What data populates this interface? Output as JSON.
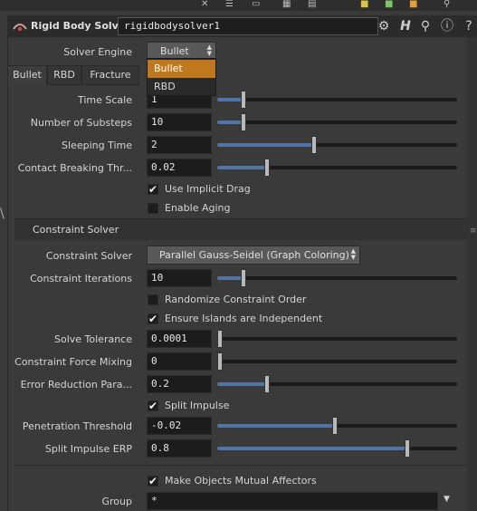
{
  "header": {
    "node_type": "Rigid Body Solver",
    "node_name": "rigidbodysolver1",
    "icons": [
      "gear-icon",
      "help-cursor-icon",
      "search-icon",
      "info-icon",
      "question-icon"
    ]
  },
  "solver_engine": {
    "label": "Solver Engine",
    "value": "Bullet",
    "options": [
      "Bullet",
      "RBD"
    ],
    "selected": "Bullet"
  },
  "tabs": [
    {
      "label": "Bullet",
      "active": true
    },
    {
      "label": "RBD",
      "active": false
    },
    {
      "label": "Fracture",
      "active": false
    }
  ],
  "params_top": [
    {
      "label": "Time Scale",
      "value": "1",
      "slider": 0.1
    },
    {
      "label": "Number of Substeps",
      "value": "10",
      "slider": 0.1
    },
    {
      "label": "Sleeping Time",
      "value": "2",
      "slider": 0.4
    },
    {
      "label": "Contact Breaking Thr...",
      "value": "0.02",
      "slider": 0.2
    }
  ],
  "checks_top": [
    {
      "label": "Use Implicit Drag",
      "checked": true
    },
    {
      "label": "Enable Aging",
      "checked": false
    }
  ],
  "constraint_section": {
    "title": "Constraint Solver",
    "solver_label": "Constraint Solver",
    "solver_value": "Parallel Gauss-Seidel (Graph Coloring)",
    "iterations_label": "Constraint Iterations",
    "iterations_value": "10",
    "iterations_slider": 0.1
  },
  "checks_mid": [
    {
      "label": "Randomize Constraint Order",
      "checked": false
    },
    {
      "label": "Ensure Islands are Independent",
      "checked": true
    }
  ],
  "params_mid": [
    {
      "label": "Solve Tolerance",
      "value": "0.0001",
      "slider": 0.0
    },
    {
      "label": "Constraint Force Mixing",
      "value": "0",
      "slider": 0.0
    },
    {
      "label": "Error Reduction Para...",
      "value": "0.2",
      "slider": 0.2
    }
  ],
  "split_impulse": {
    "label": "Split Impulse",
    "checked": true
  },
  "params_bottom": [
    {
      "label": "Penetration Threshold",
      "value": "-0.02",
      "slider": 0.49
    },
    {
      "label": "Split Impulse ERP",
      "value": "0.8",
      "slider": 0.8
    }
  ],
  "mutual_affectors": {
    "label": "Make Objects Mutual Affectors",
    "checked": true
  },
  "group": {
    "label": "Group",
    "value": "*"
  },
  "colors": {
    "accent": "#4f74a6",
    "menu_highlight": "#c0781e",
    "background": "#3a3a3a"
  }
}
